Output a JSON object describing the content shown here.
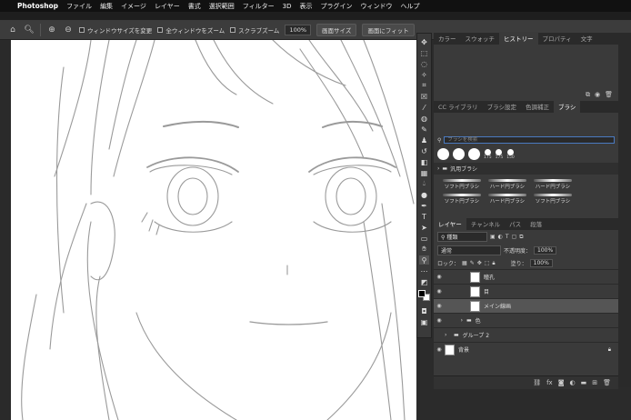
{
  "menubar": {
    "app_name": "Photoshop",
    "items": [
      "ファイル",
      "編集",
      "イメージ",
      "レイヤー",
      "書式",
      "選択範囲",
      "フィルター",
      "3D",
      "表示",
      "プラグイン",
      "ウィンドウ",
      "ヘルプ"
    ]
  },
  "options": {
    "resize_windows": "ウィンドウサイズを変更",
    "zoom_all": "全ウィンドウをズーム",
    "scrubby_zoom": "スクラブズーム",
    "zoom_value": "100%",
    "fit_screen": "画面サイズ",
    "fill_screen": "画面にフィット"
  },
  "top_panel_tabs": [
    "カラー",
    "スウォッチ",
    "ヒストリー",
    "プロパティ",
    "文字"
  ],
  "top_panel_active": "ヒストリー",
  "brush_panel_tabs": [
    "CC ライブラリ",
    "ブラシ設定",
    "色調補正",
    "ブラシ"
  ],
  "brush_panel_active": "ブラシ",
  "brush_search_placeholder": "ブラシを検索",
  "brush_sizes": [
    "175",
    "175",
    "150"
  ],
  "brush_folder": "汎用ブラシ",
  "brush_presets": [
    "ソフト円ブラシ",
    "ハード円ブラシ",
    "ハード円ブラシ",
    "ソフト円ブラシ",
    "ハード円ブラシ",
    "ソフト円ブラシ"
  ],
  "layer_panel_tabs": [
    "レイヤー",
    "チャンネル",
    "パス",
    "段落"
  ],
  "layer_panel_active": "レイヤー",
  "layer_filter": "種類",
  "blend_mode": "通常",
  "opacity_label": "不透明度：",
  "opacity_value": "100%",
  "lock_label": "ロック：",
  "fill_label": "塗り：",
  "fill_value": "100%",
  "layers": [
    {
      "name": "瞳孔",
      "indent": 2,
      "selected": false
    },
    {
      "name": "目",
      "indent": 2,
      "selected": false
    },
    {
      "name": "メイン線画",
      "indent": 2,
      "selected": true
    },
    {
      "name": "色",
      "indent": 1,
      "selected": false,
      "folder": true
    },
    {
      "name": "グループ 2",
      "indent": 0,
      "selected": false,
      "folder": true
    },
    {
      "name": "背景",
      "indent": 0,
      "selected": false
    }
  ],
  "colors": {
    "accent_blue": "#4a7ac0",
    "panel_bg": "#3a3a3a",
    "canvas": "#ffffff"
  }
}
